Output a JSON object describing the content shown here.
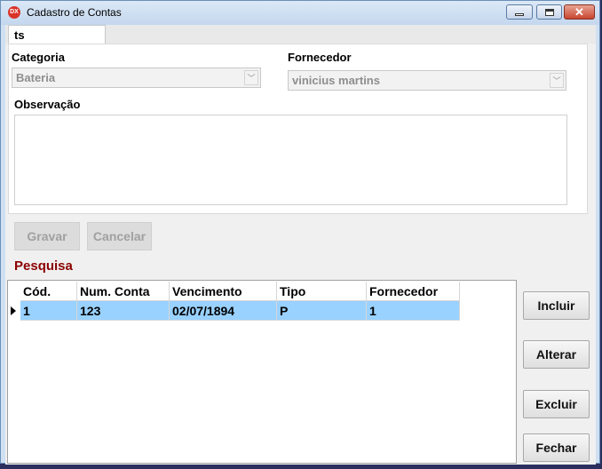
{
  "window": {
    "title": "Cadastro de Contas",
    "app_icon_text": "DX"
  },
  "tab": {
    "label": "ts"
  },
  "form": {
    "categoria_label": "Categoria",
    "categoria_value": "Bateria",
    "fornecedor_label": "Fornecedor",
    "fornecedor_value": "vinicius martins",
    "observacao_label": "Observação"
  },
  "buttons": {
    "gravar": "Gravar",
    "cancelar": "Cancelar"
  },
  "search": {
    "title": "Pesquisa"
  },
  "grid": {
    "columns": [
      "Cód.",
      "Num. Conta",
      "Vencimento",
      "Tipo",
      "Fornecedor"
    ],
    "rows": [
      [
        "1",
        "123",
        "02/07/1894",
        "P",
        "1"
      ]
    ]
  },
  "actions": {
    "incluir": "Incluir",
    "alterar": "Alterar",
    "excluir": "Excluir",
    "fechar": "Fechar"
  }
}
